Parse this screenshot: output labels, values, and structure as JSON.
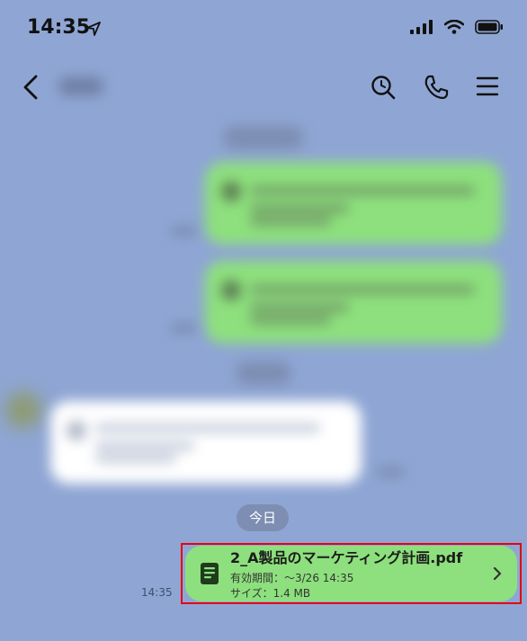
{
  "status_bar": {
    "time": "14:35",
    "icons": [
      "location-arrow-icon",
      "signal-bars-icon",
      "wifi-icon",
      "battery-icon"
    ]
  },
  "header": {
    "icons": [
      "back-chevron-icon",
      "search-icon",
      "phone-icon",
      "menu-icon"
    ]
  },
  "chat": {
    "date_chip": "今日",
    "file_message": {
      "file_name": "2_A製品のマーケティング計画.pdf",
      "expiry": "有効期間：～3/26 14:35",
      "size": "サイズ：1.4 MB",
      "time": "14:35",
      "icon": "document-icon"
    }
  },
  "colors": {
    "background": "#8fa6d4",
    "bubble_green": "#8de07d",
    "highlight_border": "#e60012",
    "date_chip": "#7d8eb2"
  }
}
